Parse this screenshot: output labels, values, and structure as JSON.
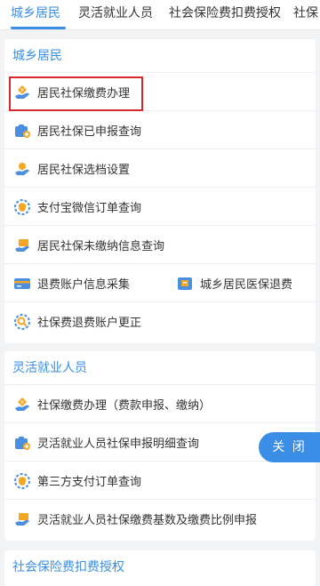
{
  "tabs": [
    {
      "label": "城乡居民"
    },
    {
      "label": "灵活就业人员"
    },
    {
      "label": "社会保险费扣费授权"
    },
    {
      "label": "社保"
    }
  ],
  "sections": [
    {
      "title": "城乡居民",
      "items": [
        {
          "label": "居民社保缴费办理",
          "icon": "hand-yen-icon"
        },
        {
          "label": "居民社保已申报查询",
          "icon": "medical-kit-icon"
        },
        {
          "label": "居民社保选档设置",
          "icon": "hand-circle-icon"
        },
        {
          "label": "支付宝微信订单查询",
          "icon": "shield-badge-icon"
        },
        {
          "label": "居民社保未缴纳信息查询",
          "icon": "hand-card-icon"
        },
        {
          "label": "退费账户信息采集",
          "icon": "bank-card-icon"
        },
        {
          "label": "城乡居民医保退费",
          "icon": "wallet-icon"
        },
        {
          "label": "社保费退费账户更正",
          "icon": "search-doc-icon"
        }
      ]
    },
    {
      "title": "灵活就业人员",
      "items": [
        {
          "label": "社保缴费办理（费款申报、缴纳）",
          "icon": "hand-yen-icon"
        },
        {
          "label": "灵活就业人员社保申报明细查询",
          "icon": "medical-kit-icon"
        },
        {
          "label": "第三方支付订单查询",
          "icon": "shield-badge-icon"
        },
        {
          "label": "灵活就业人员社保缴费基数及缴费比例申报",
          "icon": "hand-card-icon"
        }
      ]
    },
    {
      "title": "社会保险费扣费授权"
    }
  ],
  "close_button": {
    "label": "关 闭"
  },
  "colors": {
    "accent": "#3a8ee6",
    "highlight": "#d7282a",
    "icon_orange": "#f5a623"
  }
}
